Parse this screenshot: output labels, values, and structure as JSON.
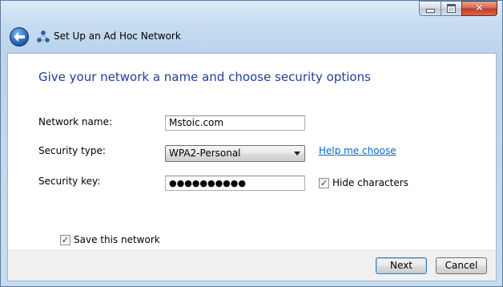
{
  "window": {
    "title": "Set Up an Ad Hoc Network",
    "controls": {
      "minimize": "minimize",
      "maximize": "maximize",
      "close": "✕"
    }
  },
  "instruction": "Give your network a name and choose security options",
  "form": {
    "network_name_label": "Network name:",
    "network_name_value": "Mstoic.com",
    "security_type_label": "Security type:",
    "security_type_value": "WPA2-Personal",
    "help_link": "Help me choose",
    "security_key_label": "Security key:",
    "security_key_value": "●●●●●●●●●●",
    "hide_characters_label": "Hide characters",
    "hide_characters_checked": true,
    "save_network_label": "Save this network",
    "save_network_checked": true
  },
  "buttons": {
    "next": "Next",
    "cancel": "Cancel"
  },
  "icons": {
    "back": "back-arrow-icon",
    "wizard": "network-icon",
    "check": "✓"
  },
  "colors": {
    "instruction": "#1e3f9a",
    "link": "#0066cc",
    "close_button": "#c2391f"
  }
}
